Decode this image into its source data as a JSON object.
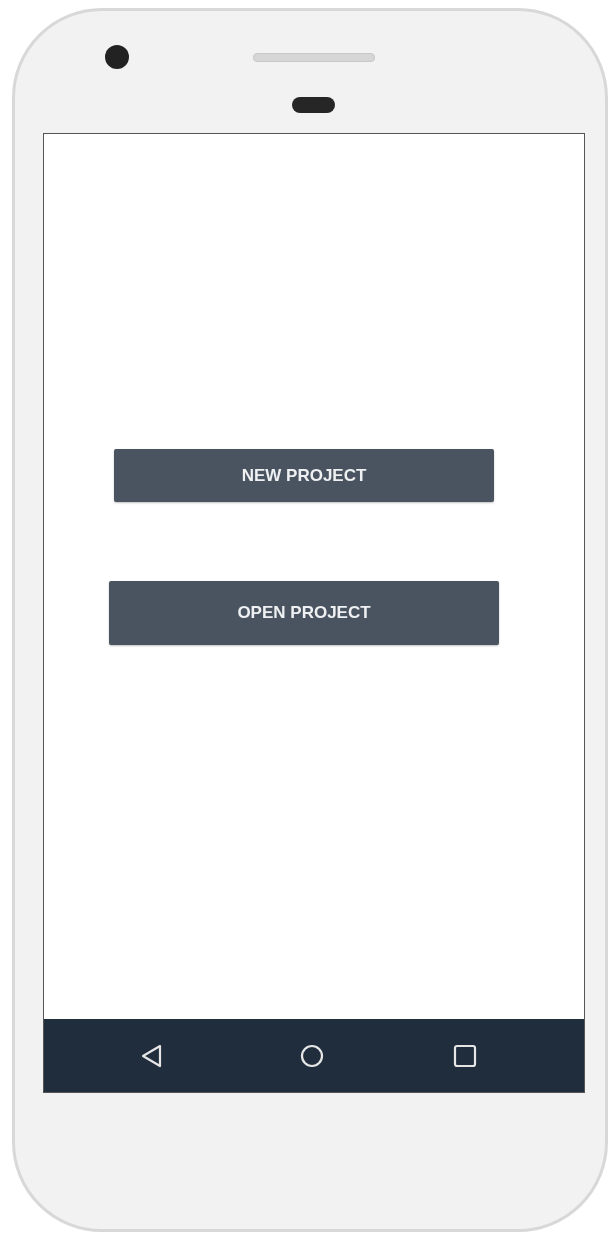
{
  "buttons": [
    {
      "label": "NEW PROJECT"
    },
    {
      "label": "OPEN PROJECT"
    }
  ]
}
